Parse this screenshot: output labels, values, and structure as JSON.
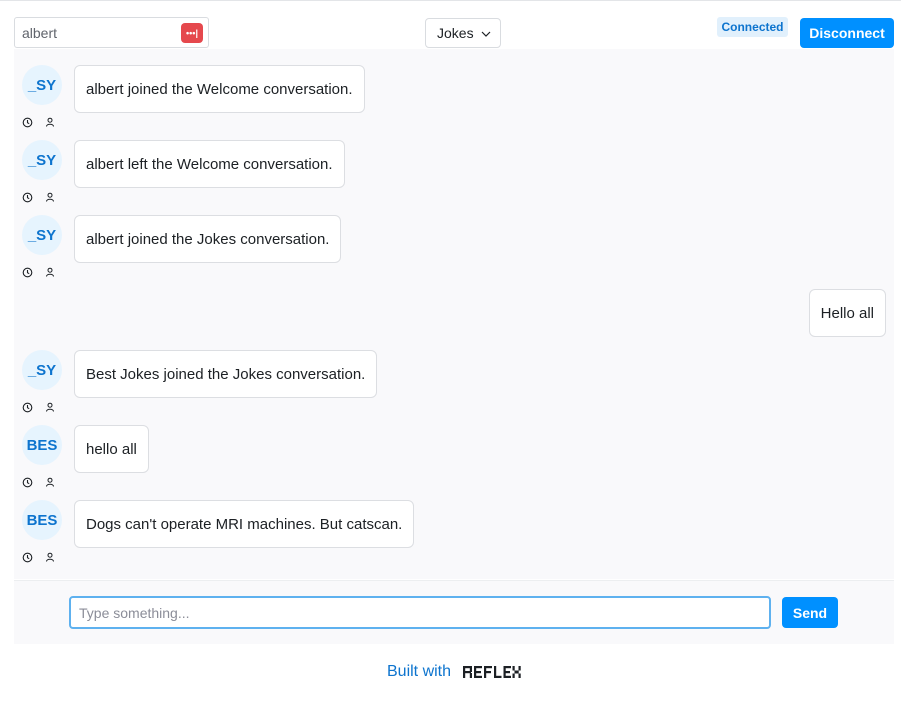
{
  "header": {
    "username_value": "albert",
    "password_icon": "password-manager-icon",
    "room_selected": "Jokes",
    "status_text": "Connected",
    "disconnect_label": "Disconnect"
  },
  "messages": [
    {
      "side": "left",
      "avatar": "_SY",
      "text": "albert joined the Welcome conversation."
    },
    {
      "side": "left",
      "avatar": "_SY",
      "text": "albert left the Welcome conversation."
    },
    {
      "side": "left",
      "avatar": "_SY",
      "text": "albert joined the Jokes conversation."
    },
    {
      "side": "right",
      "text": "Hello all"
    },
    {
      "side": "left",
      "avatar": "_SY",
      "text": "Best Jokes joined the Jokes conversation."
    },
    {
      "side": "left",
      "avatar": "BES",
      "text": "hello all"
    },
    {
      "side": "left",
      "avatar": "BES",
      "text": "Dogs can't operate MRI machines. But catscan."
    }
  ],
  "composer": {
    "placeholder": "Type something...",
    "send_label": "Send"
  },
  "footer": {
    "built_with": "Built with",
    "logo_text": "REFLEX"
  },
  "colors": {
    "accent": "#0090ff",
    "accent_text": "#0d74ce",
    "badge_bg": "#e1f0fc",
    "password_icon": "#e5484d"
  }
}
